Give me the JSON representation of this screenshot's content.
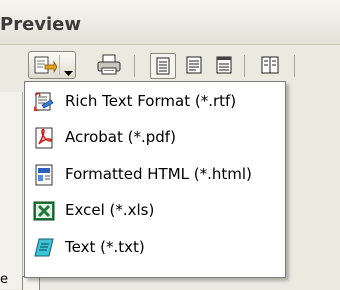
{
  "window": {
    "title": "Preview"
  },
  "toolbar": {
    "export_icon": "export-document-icon",
    "dropdown_icon": "chevron-down-icon",
    "print_icon": "printer-icon",
    "view_icons": [
      "single-page-view-icon",
      "page-width-view-icon",
      "text-view-icon",
      "two-page-view-icon"
    ]
  },
  "export_menu": {
    "items": [
      {
        "label": "Rich Text Format (*.rtf)",
        "icon": "rtf-icon"
      },
      {
        "label": "Acrobat (*.pdf)",
        "icon": "pdf-icon"
      },
      {
        "label": "Formatted HTML (*.html)",
        "icon": "html-icon"
      },
      {
        "label": "Excel (*.xls)",
        "icon": "excel-icon"
      },
      {
        "label": "Text (*.txt)",
        "icon": "text-file-icon"
      }
    ]
  },
  "background": {
    "fragment_text": "e"
  },
  "colors": {
    "menu_bg": "#ffffff",
    "toolbar_bg": "#ebe9e0",
    "highlight": "#316ac5"
  }
}
